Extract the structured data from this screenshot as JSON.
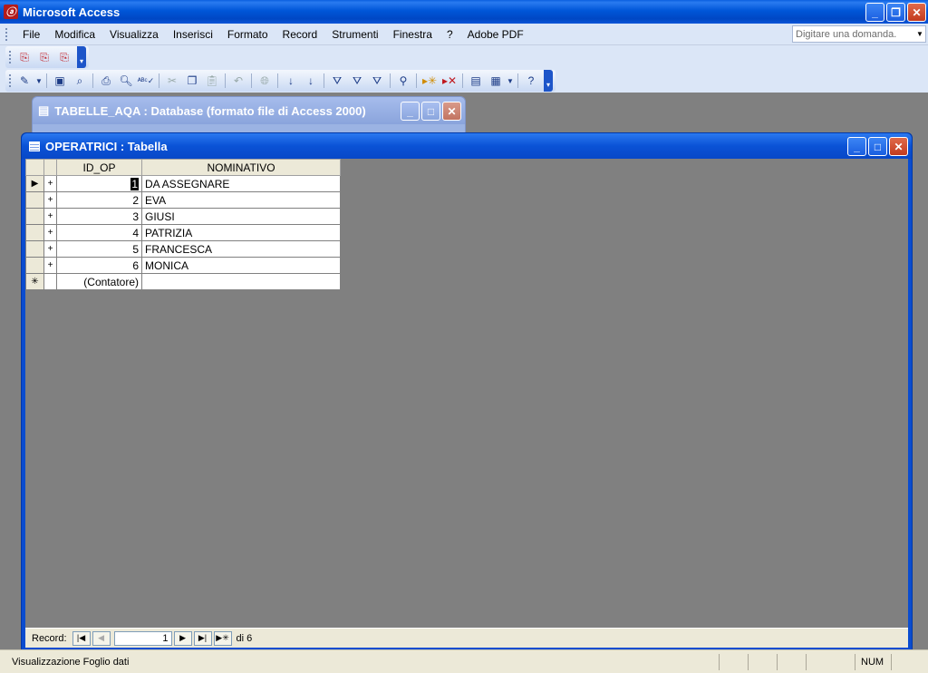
{
  "app": {
    "title": "Microsoft Access",
    "icon": "access-key-icon"
  },
  "menu": {
    "items": [
      "File",
      "Modifica",
      "Visualizza",
      "Inserisci",
      "Formato",
      "Record",
      "Strumenti",
      "Finestra",
      "?",
      "Adobe PDF"
    ],
    "ask_placeholder": "Digitare una domanda."
  },
  "db_window": {
    "title": "TABELLE_AQA : Database (formato file di Access 2000)"
  },
  "table_window": {
    "title": "OPERATRICI : Tabella",
    "columns": [
      "ID_OP",
      "NOMINATIVO"
    ],
    "rows": [
      {
        "id": "1",
        "name": "DA ASSEGNARE"
      },
      {
        "id": "2",
        "name": "EVA"
      },
      {
        "id": "3",
        "name": "GIUSI"
      },
      {
        "id": "4",
        "name": "PATRIZIA"
      },
      {
        "id": "5",
        "name": "FRANCESCA"
      },
      {
        "id": "6",
        "name": "MONICA"
      }
    ],
    "new_row_id": "(Contatore)"
  },
  "navigator": {
    "label": "Record:",
    "current": "1",
    "total_text": "di 6"
  },
  "status": {
    "text": "Visualizzazione Foglio dati",
    "num": "NUM"
  },
  "colors": {
    "xp_title": "#0a52d6",
    "mdi_bg": "#808080",
    "menu_bg": "#dbe6f7"
  }
}
